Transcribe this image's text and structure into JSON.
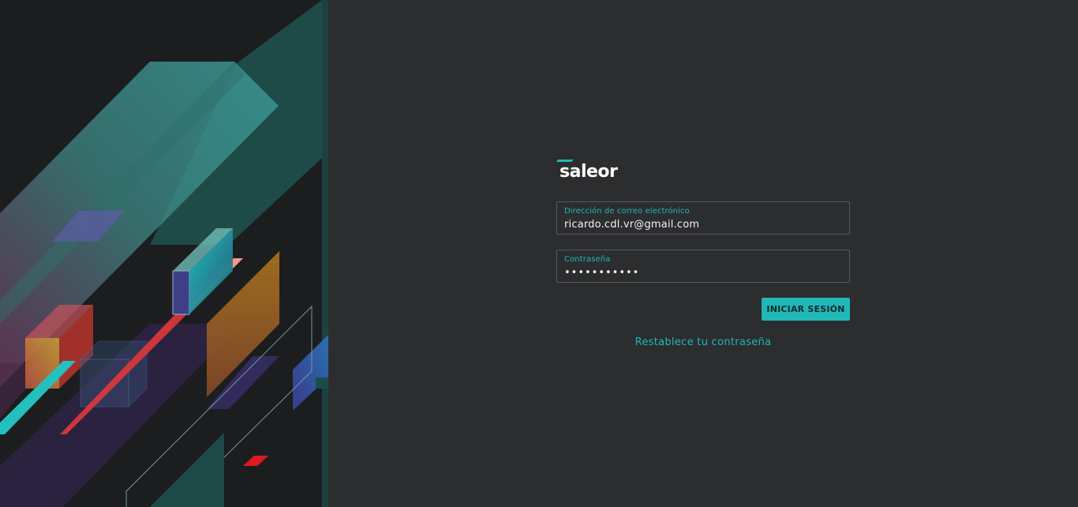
{
  "brand": {
    "logo_text": "saleor",
    "accent_color": "#1fb8b6"
  },
  "login": {
    "email_label": "Dirección de correo electrónico",
    "email_value": "ricardo.cdl.vr@gmail.com",
    "password_label": "Contraseña",
    "password_value": "•••••••••••",
    "submit_label": "INICIAR SESIÓN",
    "reset_link": "Restablece tu contraseña"
  },
  "colors": {
    "background": "#2c2d2f",
    "panel": "#1c1d1f",
    "field_border": "#58595c",
    "text": "#f2f2f2"
  }
}
